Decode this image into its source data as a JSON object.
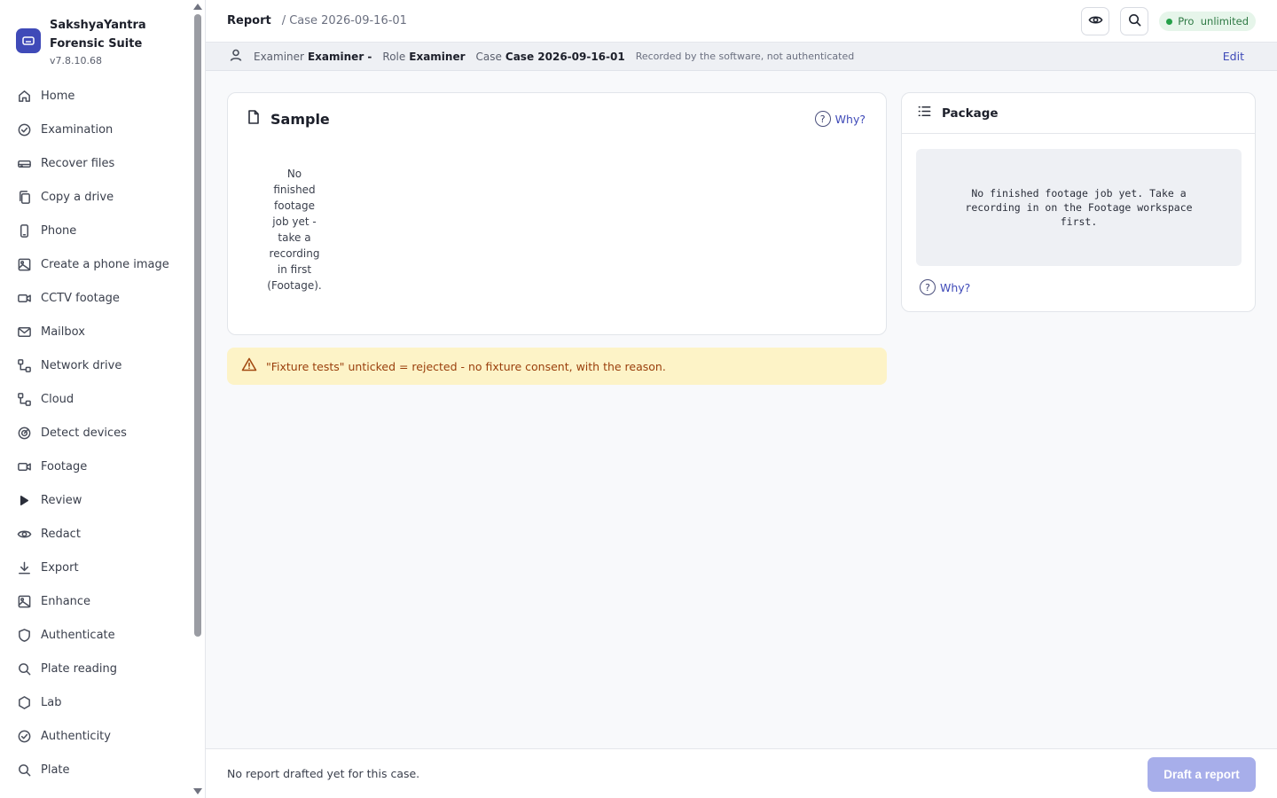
{
  "app": {
    "name_line1": "SakshyaYantra",
    "name_line2": "Forensic Suite",
    "version": "v7.8.10.68"
  },
  "sidebar": {
    "items": [
      {
        "label": "Home",
        "icon": "home-icon"
      },
      {
        "label": "Examination",
        "icon": "check-circle-icon"
      },
      {
        "label": "Recover files",
        "icon": "hard-drive-icon"
      },
      {
        "label": "Copy a drive",
        "icon": "copy-icon"
      },
      {
        "label": "Phone",
        "icon": "phone-icon"
      },
      {
        "label": "Create a phone image",
        "icon": "image-icon"
      },
      {
        "label": "CCTV footage",
        "icon": "video-icon"
      },
      {
        "label": "Mailbox",
        "icon": "mail-icon"
      },
      {
        "label": "Network drive",
        "icon": "network-icon"
      },
      {
        "label": "Cloud",
        "icon": "network-icon"
      },
      {
        "label": "Detect devices",
        "icon": "radar-icon"
      },
      {
        "label": "Footage",
        "icon": "video-icon"
      },
      {
        "label": "Review",
        "icon": "play-icon"
      },
      {
        "label": "Redact",
        "icon": "eye-icon"
      },
      {
        "label": "Export",
        "icon": "download-icon"
      },
      {
        "label": "Enhance",
        "icon": "image-icon"
      },
      {
        "label": "Authenticate",
        "icon": "shield-icon"
      },
      {
        "label": "Plate reading",
        "icon": "search-icon"
      },
      {
        "label": "Lab",
        "icon": "hexagon-icon"
      },
      {
        "label": "Authenticity",
        "icon": "check-circle-icon"
      },
      {
        "label": "Plate",
        "icon": "search-icon"
      }
    ]
  },
  "topbar": {
    "breadcrumb_main": "Report",
    "breadcrumb_sub": "/ Case 2026-09-16-01",
    "plan_label": "Pro  unlimited"
  },
  "infobar": {
    "examiner_key": "Examiner",
    "examiner_value": "Examiner -",
    "role_key": "Role",
    "role_value": "Examiner",
    "case_key": "Case",
    "case_value": "Case 2026-09-16-01",
    "note": "Recorded by the software, not authenticated",
    "edit_label": "Edit"
  },
  "sample": {
    "title": "Sample",
    "why_label": "Why?",
    "empty_message": "No finished footage job yet - take a recording in first (Footage)."
  },
  "package": {
    "title": "Package",
    "empty_message": "No finished footage job yet. Take a recording in on the Footage workspace first.",
    "why_label": "Why?"
  },
  "warning": {
    "text": "\"Fixture tests\" unticked = rejected - no fixture consent, with the reason."
  },
  "footer": {
    "status": "No report drafted yet for this case.",
    "draft_button": "Draft a report"
  },
  "colors": {
    "accent": "#3f4ab8",
    "plan_green": "#26a04a",
    "warning_bg": "#fdf3c7",
    "warning_text": "#9a3f0c",
    "draft_button_disabled": "#a7aeea"
  }
}
